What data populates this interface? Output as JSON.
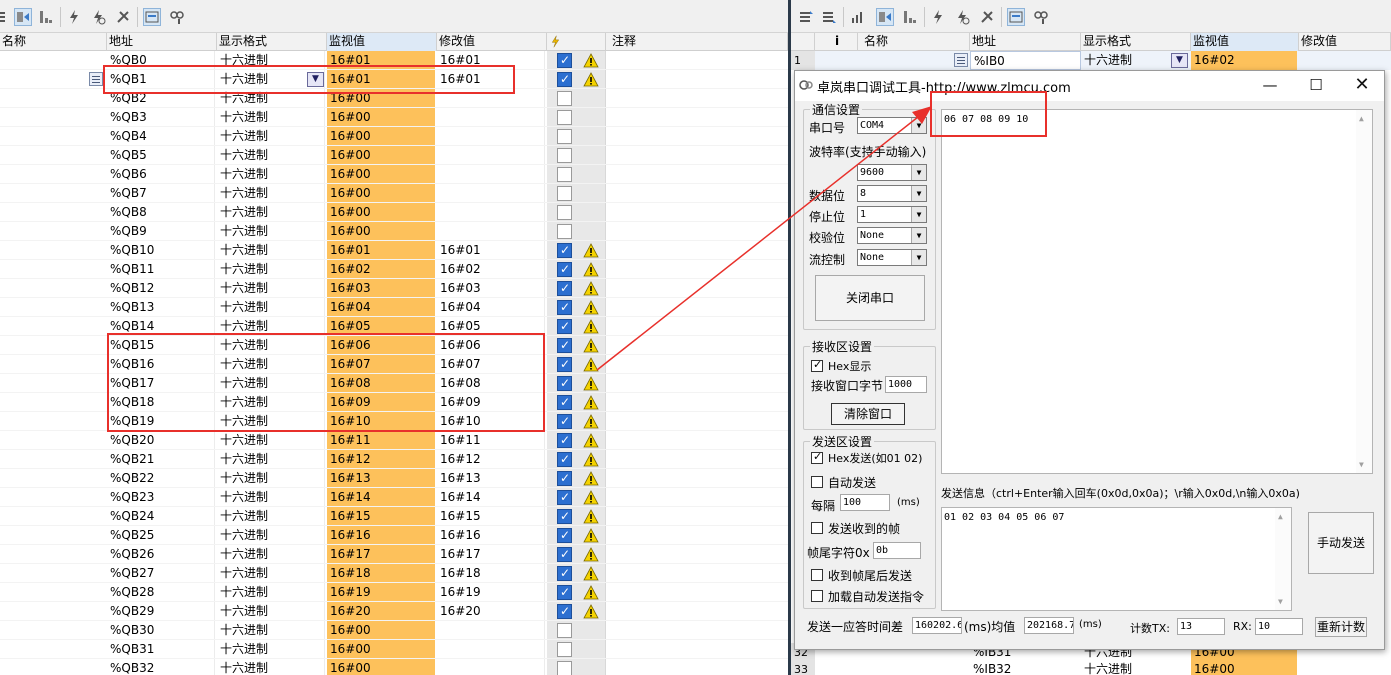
{
  "left_table": {
    "headers": {
      "name": "名称",
      "address": "地址",
      "format": "显示格式",
      "monitor": "监视值",
      "modify": "修改值",
      "comment": "注释"
    },
    "rows": [
      {
        "addr": "%QB0",
        "fmt": "十六进制",
        "mon": "16#01",
        "mod": "16#01",
        "checked": true,
        "warn": true
      },
      {
        "addr": "%QB1",
        "fmt": "十六进制",
        "mon": "16#01",
        "mod": "16#01",
        "checked": true,
        "warn": true
      },
      {
        "addr": "%QB2",
        "fmt": "十六进制",
        "mon": "16#00",
        "mod": "",
        "checked": false,
        "warn": false
      },
      {
        "addr": "%QB3",
        "fmt": "十六进制",
        "mon": "16#00",
        "mod": "",
        "checked": false,
        "warn": false
      },
      {
        "addr": "%QB4",
        "fmt": "十六进制",
        "mon": "16#00",
        "mod": "",
        "checked": false,
        "warn": false
      },
      {
        "addr": "%QB5",
        "fmt": "十六进制",
        "mon": "16#00",
        "mod": "",
        "checked": false,
        "warn": false
      },
      {
        "addr": "%QB6",
        "fmt": "十六进制",
        "mon": "16#00",
        "mod": "",
        "checked": false,
        "warn": false
      },
      {
        "addr": "%QB7",
        "fmt": "十六进制",
        "mon": "16#00",
        "mod": "",
        "checked": false,
        "warn": false
      },
      {
        "addr": "%QB8",
        "fmt": "十六进制",
        "mon": "16#00",
        "mod": "",
        "checked": false,
        "warn": false
      },
      {
        "addr": "%QB9",
        "fmt": "十六进制",
        "mon": "16#00",
        "mod": "",
        "checked": false,
        "warn": false
      },
      {
        "addr": "%QB10",
        "fmt": "十六进制",
        "mon": "16#01",
        "mod": "16#01",
        "checked": true,
        "warn": true
      },
      {
        "addr": "%QB11",
        "fmt": "十六进制",
        "mon": "16#02",
        "mod": "16#02",
        "checked": true,
        "warn": true
      },
      {
        "addr": "%QB12",
        "fmt": "十六进制",
        "mon": "16#03",
        "mod": "16#03",
        "checked": true,
        "warn": true
      },
      {
        "addr": "%QB13",
        "fmt": "十六进制",
        "mon": "16#04",
        "mod": "16#04",
        "checked": true,
        "warn": true
      },
      {
        "addr": "%QB14",
        "fmt": "十六进制",
        "mon": "16#05",
        "mod": "16#05",
        "checked": true,
        "warn": true
      },
      {
        "addr": "%QB15",
        "fmt": "十六进制",
        "mon": "16#06",
        "mod": "16#06",
        "checked": true,
        "warn": true
      },
      {
        "addr": "%QB16",
        "fmt": "十六进制",
        "mon": "16#07",
        "mod": "16#07",
        "checked": true,
        "warn": true
      },
      {
        "addr": "%QB17",
        "fmt": "十六进制",
        "mon": "16#08",
        "mod": "16#08",
        "checked": true,
        "warn": true
      },
      {
        "addr": "%QB18",
        "fmt": "十六进制",
        "mon": "16#09",
        "mod": "16#09",
        "checked": true,
        "warn": true
      },
      {
        "addr": "%QB19",
        "fmt": "十六进制",
        "mon": "16#10",
        "mod": "16#10",
        "checked": true,
        "warn": true
      },
      {
        "addr": "%QB20",
        "fmt": "十六进制",
        "mon": "16#11",
        "mod": "16#11",
        "checked": true,
        "warn": true
      },
      {
        "addr": "%QB21",
        "fmt": "十六进制",
        "mon": "16#12",
        "mod": "16#12",
        "checked": true,
        "warn": true
      },
      {
        "addr": "%QB22",
        "fmt": "十六进制",
        "mon": "16#13",
        "mod": "16#13",
        "checked": true,
        "warn": true
      },
      {
        "addr": "%QB23",
        "fmt": "十六进制",
        "mon": "16#14",
        "mod": "16#14",
        "checked": true,
        "warn": true
      },
      {
        "addr": "%QB24",
        "fmt": "十六进制",
        "mon": "16#15",
        "mod": "16#15",
        "checked": true,
        "warn": true
      },
      {
        "addr": "%QB25",
        "fmt": "十六进制",
        "mon": "16#16",
        "mod": "16#16",
        "checked": true,
        "warn": true
      },
      {
        "addr": "%QB26",
        "fmt": "十六进制",
        "mon": "16#17",
        "mod": "16#17",
        "checked": true,
        "warn": true
      },
      {
        "addr": "%QB27",
        "fmt": "十六进制",
        "mon": "16#18",
        "mod": "16#18",
        "checked": true,
        "warn": true
      },
      {
        "addr": "%QB28",
        "fmt": "十六进制",
        "mon": "16#19",
        "mod": "16#19",
        "checked": true,
        "warn": true
      },
      {
        "addr": "%QB29",
        "fmt": "十六进制",
        "mon": "16#20",
        "mod": "16#20",
        "checked": true,
        "warn": true
      },
      {
        "addr": "%QB30",
        "fmt": "十六进制",
        "mon": "16#00",
        "mod": "",
        "checked": false,
        "warn": false
      },
      {
        "addr": "%QB31",
        "fmt": "十六进制",
        "mon": "16#00",
        "mod": "",
        "checked": false,
        "warn": false
      },
      {
        "addr": "%QB32",
        "fmt": "十六进制",
        "mon": "16#00",
        "mod": "",
        "checked": false,
        "warn": false
      }
    ]
  },
  "right_table": {
    "headers": {
      "info": "i",
      "name": "名称",
      "address": "地址",
      "format": "显示格式",
      "monitor": "监视值",
      "modify": "修改值"
    },
    "top_row": {
      "index": "1",
      "addr": "%IB0",
      "fmt": "十六进制",
      "mon": "16#02"
    },
    "bottom_rows": [
      {
        "index": "32",
        "addr": "%IB31",
        "fmt": "十六进制",
        "mon": "16#00"
      },
      {
        "index": "33",
        "addr": "%IB32",
        "fmt": "十六进制",
        "mon": "16#00"
      }
    ]
  },
  "serial_tool": {
    "title": "卓岚串口调试工具-http://www.zlmcu.com",
    "comm_group": "通信设置",
    "port_label": "串口号",
    "port_value": "COM4",
    "baud_label": "波特率(支持手动输入)",
    "baud_value": "9600",
    "databits_label": "数据位",
    "databits_value": "8",
    "stopbits_label": "停止位",
    "stopbits_value": "1",
    "parity_label": "校验位",
    "parity_value": "None",
    "flow_label": "流控制",
    "flow_value": "None",
    "close_port_button": "关闭串口",
    "recv_group": "接收区设置",
    "hex_display": "Hex显示",
    "recv_window_bytes_label": "接收窗口字节",
    "recv_window_bytes_value": "1000",
    "clear_window_button": "清除窗口",
    "send_group": "发送区设置",
    "hex_send": "Hex发送(如01 02)",
    "auto_send": "自动发送",
    "interval_label": "每隔",
    "interval_value": "100",
    "interval_unit": "(ms)",
    "send_received_frame": "发送收到的帧",
    "frame_tail_label": "帧尾字符0x",
    "frame_tail_value": "0b",
    "send_after_frame_tail": "收到帧尾后发送",
    "load_auto_send": "加载自动发送指令",
    "receive_content": "06 07 08 09 10",
    "send_info_label": "发送信息（ctrl+Enter输入回车(0x0d,0x0a)；\\r输入0x0d,\\n输入0x0a)",
    "send_content": "01 02 03 04 05 06 07",
    "manual_send_button": "手动发送",
    "response_time_label": "发送一应答时间差",
    "response_time_value": "160202.6",
    "response_time_unit_avg": "(ms)均值",
    "avg_value": "202168.7",
    "avg_unit": "(ms)",
    "tx_label": "计数TX:",
    "tx_value": "13",
    "rx_label": "RX:",
    "rx_value": "10",
    "reset_count_button": "重新计数"
  },
  "colors": {
    "monitor_cell": "#fdc15b",
    "highlight_box": "#e8302b",
    "checkbox_checked": "#2c6fd0"
  }
}
